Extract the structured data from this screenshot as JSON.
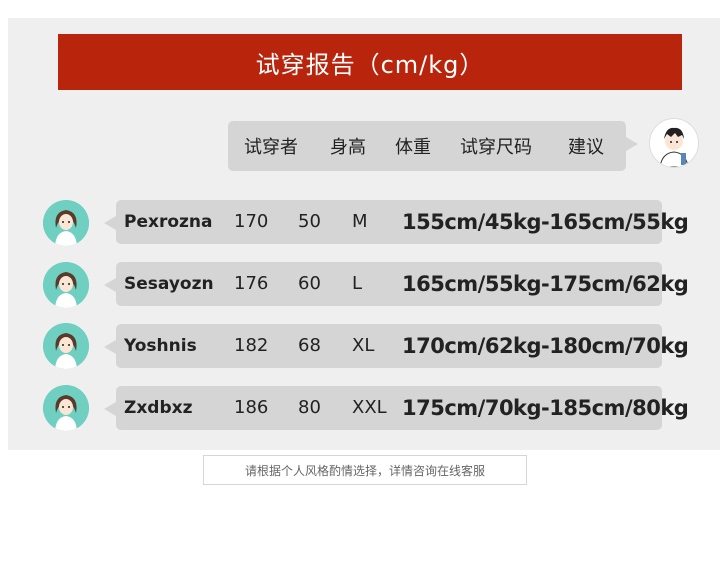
{
  "banner": {
    "title": "试穿报告（cm/kg）"
  },
  "header": {
    "columns": [
      "试穿者",
      "身高",
      "体重",
      "试穿尺码",
      "建议"
    ]
  },
  "rows": [
    {
      "name": "Pexrozna",
      "height": "170",
      "weight": "50",
      "size": "M",
      "suggestion": "155cm/45kg-165cm/55kg"
    },
    {
      "name": "Sesayozn",
      "height": "176",
      "weight": "60",
      "size": "L",
      "suggestion": "165cm/55kg-175cm/62kg"
    },
    {
      "name": "Yoshnis",
      "height": "182",
      "weight": "68",
      "size": "XL",
      "suggestion": "170cm/62kg-180cm/70kg"
    },
    {
      "name": "Zxdbxz",
      "height": "186",
      "weight": "80",
      "size": "XXL",
      "suggestion": "175cm/70kg-185cm/80kg"
    }
  ],
  "footer": {
    "note": "请根据个人风格酌情选择，详情咨询在线客服"
  },
  "colors": {
    "banner": "#b9250c",
    "panel": "#efefef",
    "bubble": "#d5d5d5",
    "avatar_bg": "#6fcfc1"
  }
}
